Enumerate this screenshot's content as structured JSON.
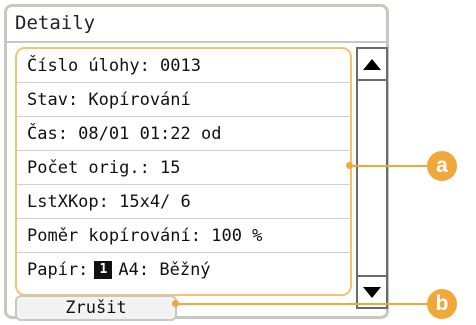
{
  "title": "Detaily",
  "rows": [
    {
      "text": "Číslo úlohy: 0013"
    },
    {
      "text": "Stav: Kopírování"
    },
    {
      "text": "Čas: 08/01 01:22 od"
    },
    {
      "text": "Počet orig.: 15"
    },
    {
      "text": "LstXKop: 15x4/ 6"
    },
    {
      "text": "Poměr kopírování: 100 %"
    }
  ],
  "paper_row": {
    "label": "Papír:",
    "tray": "1",
    "value": "A4: Běžný"
  },
  "cancel_label": "Zrušit",
  "callouts": {
    "a": "a",
    "b": "b"
  },
  "icons": {
    "scroll_up": "triangle-up-icon",
    "scroll_down": "triangle-down-icon"
  },
  "colors": {
    "callout": "#f0a83a",
    "list_highlight": "#f3c46f"
  }
}
